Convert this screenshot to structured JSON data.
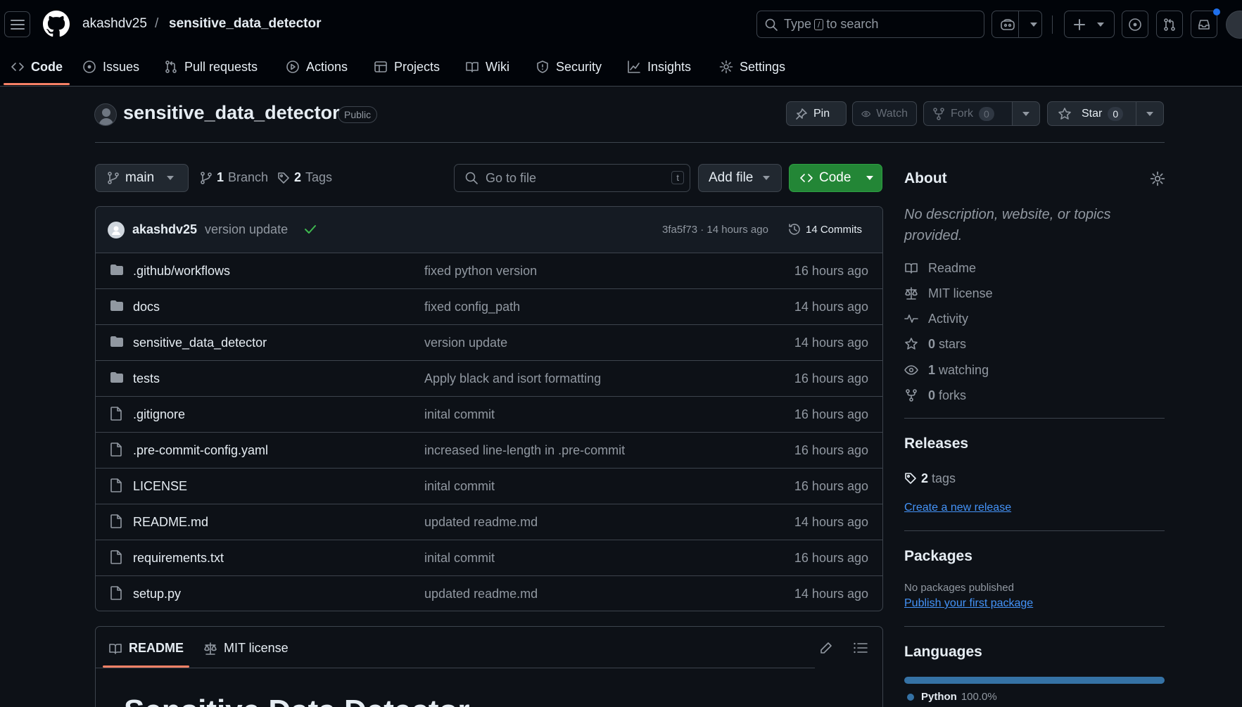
{
  "header": {
    "owner": "akashdv25",
    "separator": "/",
    "repo": "sensitive_data_detector",
    "search_pre": "Type",
    "search_key": "/",
    "search_post": "to search"
  },
  "nav": {
    "tabs": [
      {
        "label": "Code"
      },
      {
        "label": "Issues"
      },
      {
        "label": "Pull requests"
      },
      {
        "label": "Actions"
      },
      {
        "label": "Projects"
      },
      {
        "label": "Wiki"
      },
      {
        "label": "Security"
      },
      {
        "label": "Insights"
      },
      {
        "label": "Settings"
      }
    ]
  },
  "repo": {
    "title": "sensitive_data_detector",
    "visibility": "Public",
    "pin_label": "Pin",
    "watch_label": "Watch",
    "fork_label": "Fork",
    "fork_count": "0",
    "star_label": "Star",
    "star_count": "0"
  },
  "toolbar": {
    "branch": "main",
    "branch_count": "1",
    "branch_word": "Branch",
    "tag_count": "2",
    "tag_word": "Tags",
    "goto_placeholder": "Go to file",
    "goto_key": "t",
    "add_file": "Add file",
    "code": "Code"
  },
  "commit": {
    "user": "akashdv25",
    "message": "version update",
    "sha_time": "3fa5f73 · 14 hours ago",
    "commits": "14 Commits"
  },
  "files": [
    {
      "name": ".github/workflows",
      "message": "fixed python version",
      "time": "16 hours ago",
      "type": "dir"
    },
    {
      "name": "docs",
      "message": "fixed config_path",
      "time": "14 hours ago",
      "type": "dir"
    },
    {
      "name": "sensitive_data_detector",
      "message": "version update",
      "time": "14 hours ago",
      "type": "dir"
    },
    {
      "name": "tests",
      "message": "Apply black and isort formatting",
      "time": "16 hours ago",
      "type": "dir"
    },
    {
      "name": ".gitignore",
      "message": "inital commit",
      "time": "16 hours ago",
      "type": "file"
    },
    {
      "name": ".pre-commit-config.yaml",
      "message": "increased line-length in .pre-commit",
      "time": "16 hours ago",
      "type": "file"
    },
    {
      "name": "LICENSE",
      "message": "inital commit",
      "time": "16 hours ago",
      "type": "file"
    },
    {
      "name": "README.md",
      "message": "updated readme.md",
      "time": "14 hours ago",
      "type": "file"
    },
    {
      "name": "requirements.txt",
      "message": "inital commit",
      "time": "16 hours ago",
      "type": "file"
    },
    {
      "name": "setup.py",
      "message": "updated readme.md",
      "time": "14 hours ago",
      "type": "file"
    }
  ],
  "readme": {
    "tab_readme": "README",
    "tab_license": "MIT license",
    "heading": "Sensitive Data Detector"
  },
  "about": {
    "title": "About",
    "description": "No description, website, or topics provided.",
    "readme": "Readme",
    "license": "MIT license",
    "activity": "Activity",
    "stars_count": "0",
    "stars_word": "stars",
    "watching_count": "1",
    "watching_word": "watching",
    "forks_count": "0",
    "forks_word": "forks"
  },
  "releases": {
    "title": "Releases",
    "tags_count": "2",
    "tags_word": "tags",
    "create_link": "Create a new release"
  },
  "packages": {
    "title": "Packages",
    "none_text": "No packages published",
    "publish_link": "Publish your first package"
  },
  "languages": {
    "title": "Languages",
    "items": [
      {
        "name": "Python",
        "percent": "100.0%",
        "color": "#3572a5"
      }
    ]
  }
}
